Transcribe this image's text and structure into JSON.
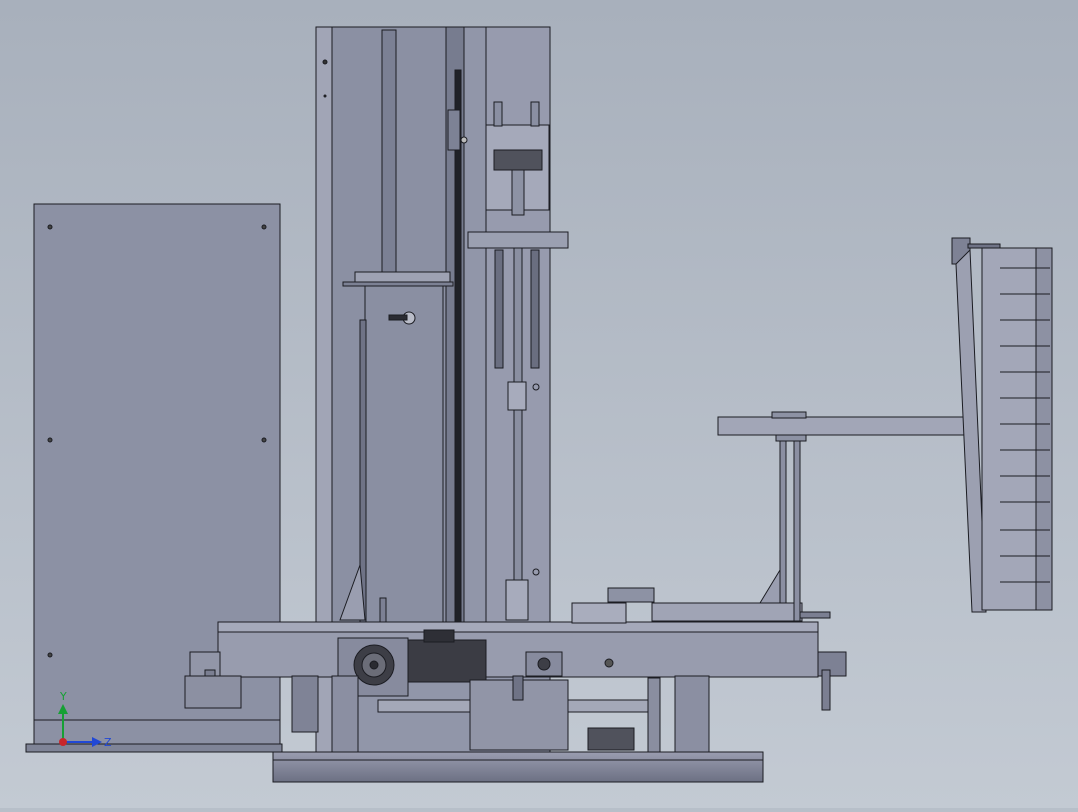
{
  "axis_triad": {
    "y_label": "Y",
    "z_label": "Z"
  },
  "colors": {
    "background_top": "#a8b0bc",
    "background_bottom": "#c3cad3",
    "panel": "#8e93a6",
    "panel_dark": "#6f7386",
    "panel_light": "#a7abbc",
    "line": "#1b1c22",
    "motor": "#3b3c44",
    "axis_y": "#16a034",
    "axis_z": "#2148d6",
    "axis_origin": "#c8262b"
  }
}
